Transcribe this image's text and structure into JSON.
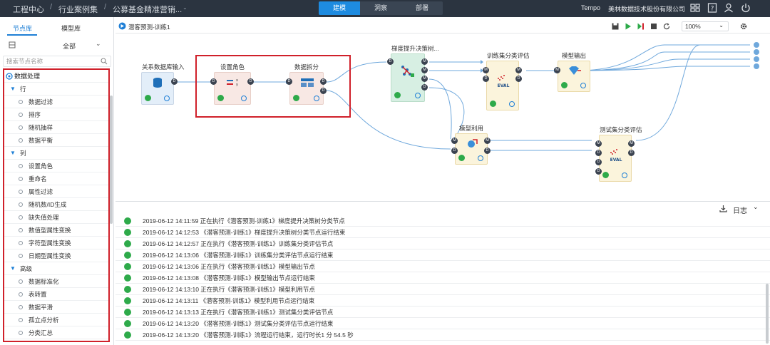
{
  "topbar": {
    "breadcrumbs": [
      "工程中心",
      "行业案例集",
      "公募基金精准营销..."
    ],
    "mode_tabs": [
      {
        "label": "建模",
        "active": true
      },
      {
        "label": "洞察",
        "active": false
      },
      {
        "label": "部署",
        "active": false
      }
    ],
    "product": "Tempo",
    "company": "美林数据技术股份有限公司"
  },
  "sidebar": {
    "tabs": [
      {
        "label": "节点库",
        "active": true
      },
      {
        "label": "模型库",
        "active": false
      }
    ],
    "filter_value": "全部",
    "search_placeholder": "搜索节点名称",
    "root_label": "数据处理",
    "groups": [
      {
        "label": "行",
        "items": [
          "数据过滤",
          "排序",
          "随机抽样",
          "数据平衡"
        ]
      },
      {
        "label": "列",
        "items": [
          "设置角色",
          "重命名",
          "属性过滤",
          "随机数/ID生成",
          "缺失值处理",
          "数值型属性变换",
          "字符型属性变换",
          "日期型属性变换"
        ]
      },
      {
        "label": "高级",
        "items": [
          "数据标准化",
          "表转置",
          "数据平滑",
          "孤立点分析",
          "分类汇总"
        ]
      }
    ]
  },
  "canvas": {
    "tab_title": "潜客预测-训练1",
    "zoom": "100%",
    "nodes": [
      {
        "id": "n1",
        "label": "关系数据库输入"
      },
      {
        "id": "n2",
        "label": "设置角色"
      },
      {
        "id": "n3",
        "label": "数据拆分"
      },
      {
        "id": "n4",
        "label": "梯度提升决策树..."
      },
      {
        "id": "n5",
        "label": "训练集分类评估"
      },
      {
        "id": "n6",
        "label": "模型输出"
      },
      {
        "id": "n7",
        "label": "模型利用"
      },
      {
        "id": "n8",
        "label": "测试集分类评估"
      }
    ],
    "eval_text": "EVAL",
    "port_labels": {
      "data": "D",
      "model": "M"
    }
  },
  "log": {
    "label": "日志",
    "entries": [
      "2019-06-12 14:11:59 正在执行《潜客预测-训练1》梯度提升决策树分类节点",
      "2019-06-12 14:12:53 《潜客预测-训练1》梯度提升决策树分类节点运行结束",
      "2019-06-12 14:12:57 正在执行《潜客预测-训练1》训练集分类评估节点",
      "2019-06-12 14:13:06 《潜客预测-训练1》训练集分类评估节点运行结束",
      "2019-06-12 14:13:06 正在执行《潜客预测-训练1》模型输出节点",
      "2019-06-12 14:13:08 《潜客预测-训练1》模型输出节点运行结束",
      "2019-06-12 14:13:10 正在执行《潜客预测-训练1》模型利用节点",
      "2019-06-12 14:13:11 《潜客预测-训练1》模型利用节点运行结束",
      "2019-06-12 14:13:13 正在执行《潜客预测-训练1》测试集分类评估节点",
      "2019-06-12 14:13:20 《潜客预测-训练1》测试集分类评估节点运行结束",
      "2019-06-12 14:13:20 《潜客预测-训练1》流程运行结束，运行时长1 分 54.5 秒"
    ]
  },
  "colors": {
    "accent": "#1e8be0",
    "topbar": "#2b3440",
    "highlight": "#d0202a",
    "success": "#2eaa4a"
  }
}
